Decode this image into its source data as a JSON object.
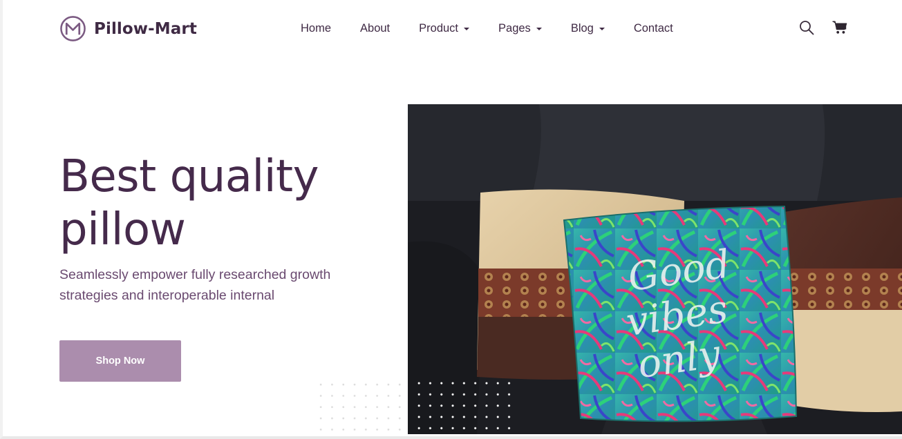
{
  "brand": {
    "name": "Pillow-Mart",
    "logo_icon": "m-circle-logo-icon",
    "color": "#3f2a44"
  },
  "nav": {
    "items": [
      {
        "label": "Home",
        "dropdown": false
      },
      {
        "label": "About",
        "dropdown": false
      },
      {
        "label": "Product",
        "dropdown": true
      },
      {
        "label": "Pages",
        "dropdown": true
      },
      {
        "label": "Blog",
        "dropdown": true
      },
      {
        "label": "Contact",
        "dropdown": false
      }
    ],
    "icons": [
      "search-icon",
      "cart-icon"
    ]
  },
  "hero": {
    "title_line1": "Best quality",
    "title_line2": "pillow",
    "subtitle": "Seamlessly empower fully researched growth strategies and interoperable internal",
    "button_label": "Shop Now",
    "button_color": "#ab8dad",
    "title_color": "#452a4b",
    "image_alt": "Tropical print pillow on black leather sofa",
    "pillow_text": "Good vibes only"
  }
}
